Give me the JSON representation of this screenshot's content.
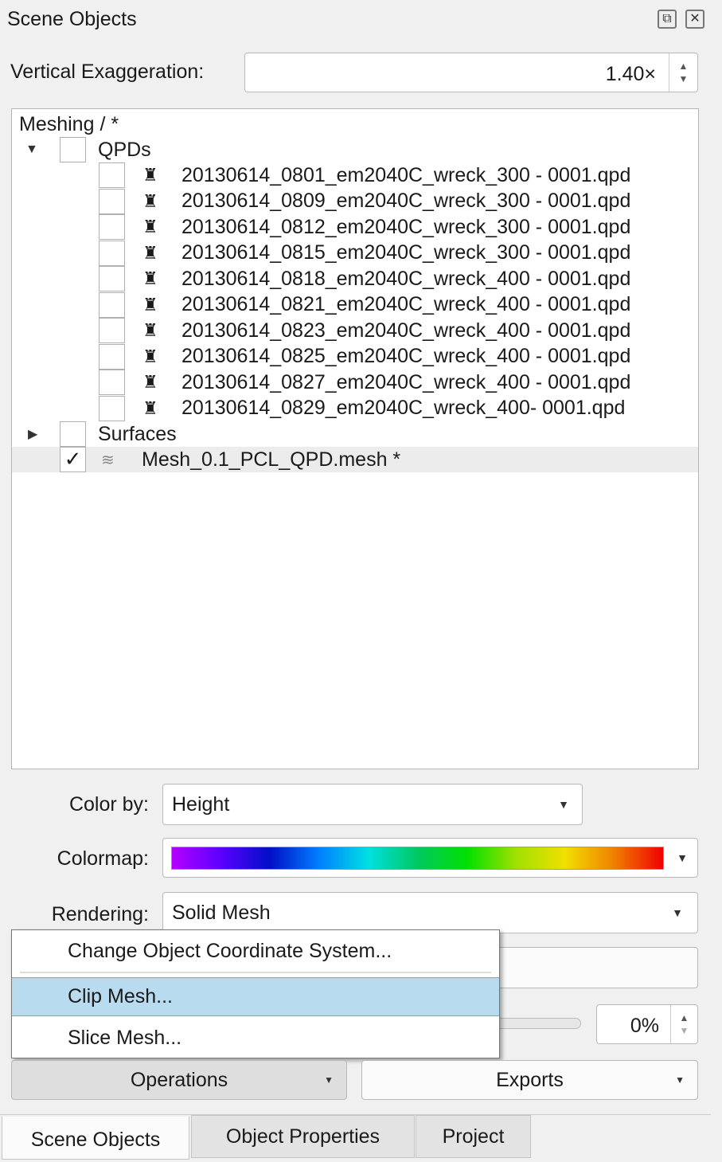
{
  "panel": {
    "title": "Scene Objects"
  },
  "vertical_exaggeration": {
    "label": "Vertical Exaggeration:",
    "value": "1.40×"
  },
  "tree": {
    "root": "Meshing / *",
    "qpds_label": "QPDs",
    "qpd_files": [
      "20130614_0801_em2040C_wreck_300 - 0001.qpd",
      "20130614_0809_em2040C_wreck_300 - 0001.qpd",
      "20130614_0812_em2040C_wreck_300 - 0001.qpd",
      "20130614_0815_em2040C_wreck_300 - 0001.qpd",
      "20130614_0818_em2040C_wreck_400 - 0001.qpd",
      "20130614_0821_em2040C_wreck_400 - 0001.qpd",
      "20130614_0823_em2040C_wreck_400 - 0001.qpd",
      "20130614_0825_em2040C_wreck_400 - 0001.qpd",
      "20130614_0827_em2040C_wreck_400 - 0001.qpd",
      "20130614_0829_em2040C_wreck_400- 0001.qpd"
    ],
    "surfaces_label": "Surfaces",
    "mesh_label": "Mesh_0.1_PCL_QPD.mesh *",
    "mesh_checked": "✓"
  },
  "color_by": {
    "label": "Color by:",
    "value": "Height"
  },
  "colormap": {
    "label": "Colormap:"
  },
  "rendering": {
    "label": "Rendering:",
    "value": "Solid Mesh"
  },
  "transparency": {
    "value": "0%",
    "fraction": 0
  },
  "menu": {
    "items": [
      "Change Object Coordinate System...",
      "Clip Mesh...",
      "Slice Mesh..."
    ],
    "highlighted": "Clip Mesh..."
  },
  "buttons": {
    "operations": "Operations",
    "exports": "Exports"
  },
  "tabs": [
    "Scene Objects",
    "Object Properties",
    "Project"
  ],
  "colors": {
    "highlight": "#b9dbef",
    "selected_row": "#ececec"
  }
}
